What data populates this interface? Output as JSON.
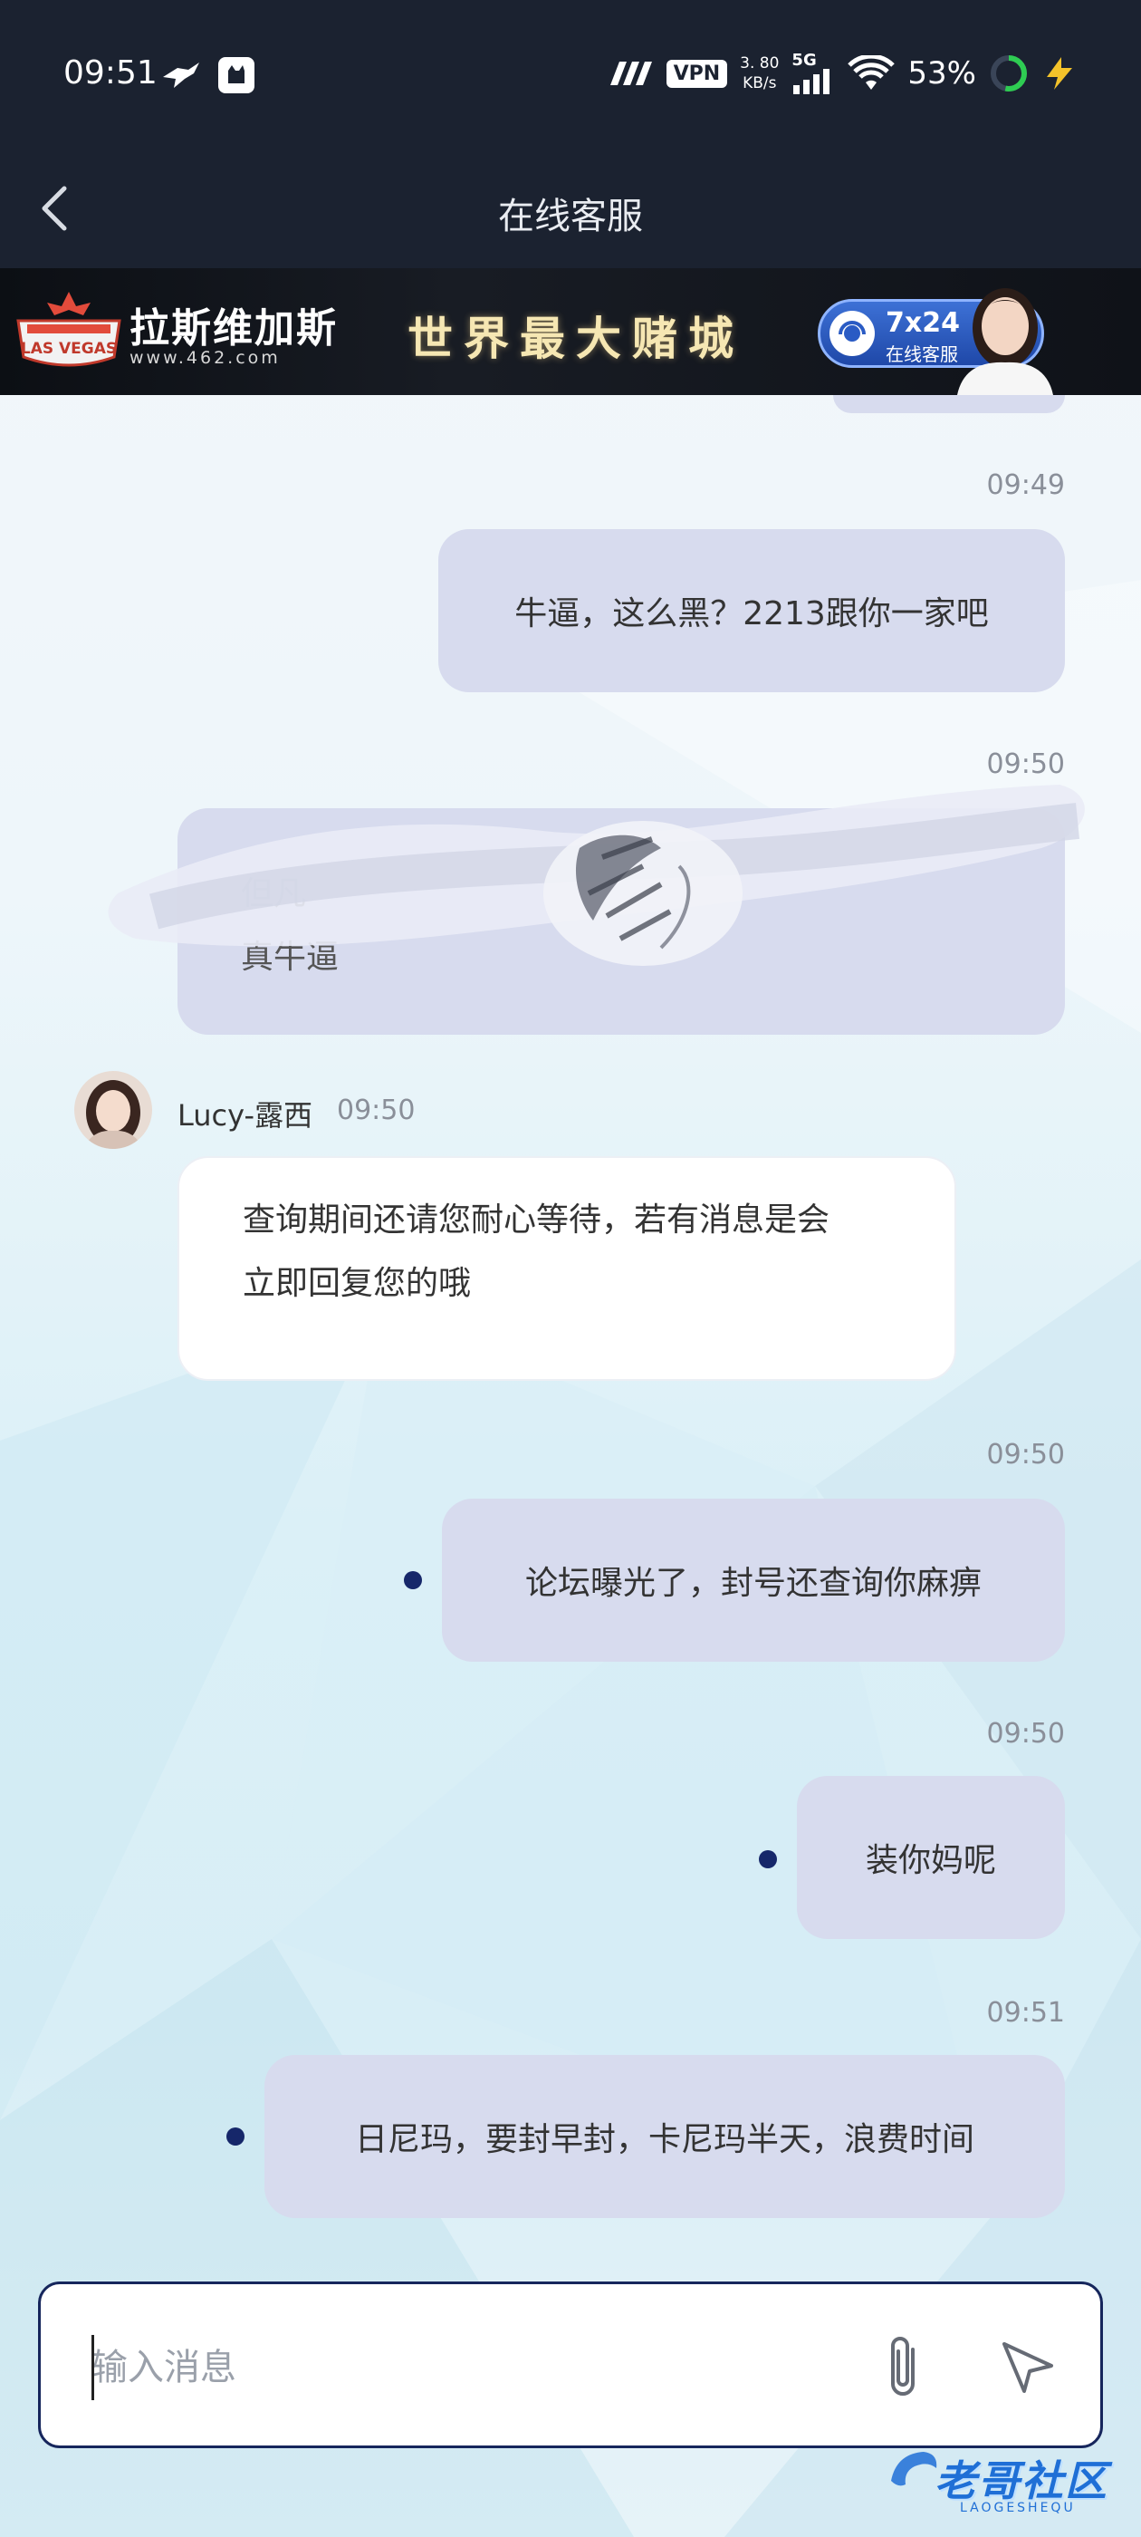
{
  "status_bar": {
    "time": "09:51",
    "vpn": "VPN",
    "net_speed_value": "3. 80",
    "net_speed_unit": "KB/s",
    "network": "5G",
    "battery": "53%"
  },
  "header": {
    "title": "在线客服"
  },
  "banner": {
    "logo_text": "LAS VEGAS",
    "brand": "拉斯维加斯",
    "url": "www.462.com",
    "slogan": "世界最大赌城",
    "service_hours": "7x24",
    "service_label": "在线客服"
  },
  "messages": [
    {
      "side": "out",
      "time": "09:49",
      "text": "牛逼，这么黑？2213跟你一家吧"
    },
    {
      "side": "out",
      "time": "09:50",
      "text_line1": "但凡",
      "text_line2": "真牛逼",
      "redacted": true
    },
    {
      "side": "in",
      "sender": "Lucy-露西",
      "time": "09:50",
      "text_line1": "查询期间还请您耐心等待，若有消息是会",
      "text_line2": "立即回复您的哦"
    },
    {
      "side": "out",
      "time": "09:50",
      "text": "论坛曝光了，封号还查询你麻痹"
    },
    {
      "side": "out",
      "time": "09:50",
      "text": "装你妈呢"
    },
    {
      "side": "out",
      "time": "09:51",
      "text": "日尼玛，要封早封，卡尼玛半天，浪费时间"
    }
  ],
  "input": {
    "placeholder": "输入消息",
    "value": ""
  },
  "watermark": {
    "text": "老哥社区",
    "sub": "LAOGESHEQU"
  },
  "colors": {
    "header_bg": "#1b2230",
    "bubble_out": "#d7dbee",
    "bubble_in": "#ffffff",
    "unread_dot": "#16276a",
    "input_border": "#16265c"
  }
}
